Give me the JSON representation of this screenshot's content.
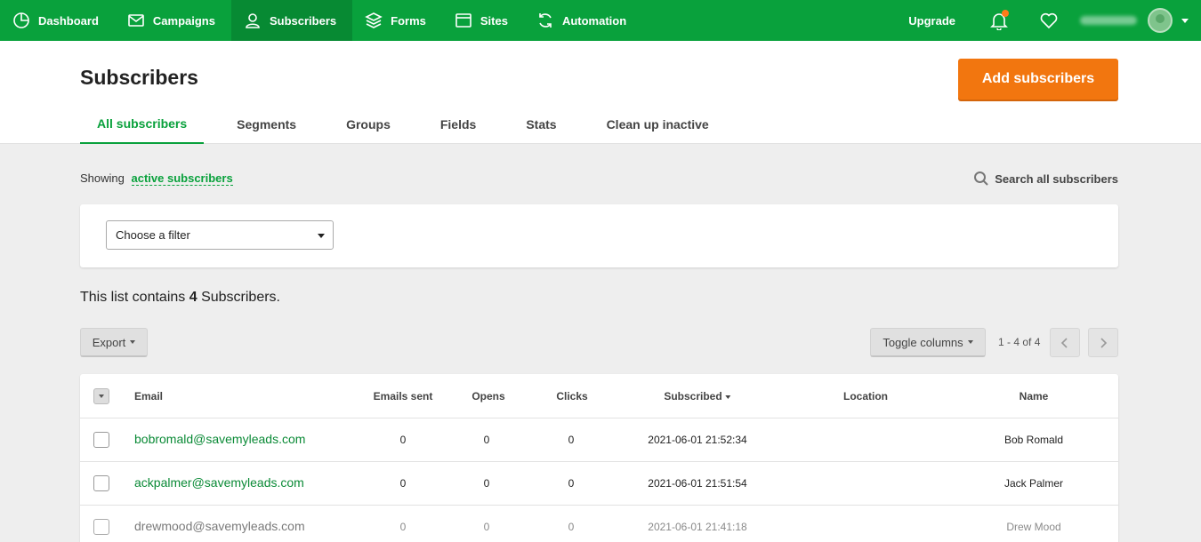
{
  "nav": {
    "items": [
      {
        "label": "Dashboard",
        "icon": "dashboard-icon"
      },
      {
        "label": "Campaigns",
        "icon": "envelope-icon"
      },
      {
        "label": "Subscribers",
        "icon": "user-icon",
        "active": true
      },
      {
        "label": "Forms",
        "icon": "layers-icon"
      },
      {
        "label": "Sites",
        "icon": "browser-window-icon"
      },
      {
        "label": "Automation",
        "icon": "refresh-icon"
      }
    ],
    "upgrade": "Upgrade",
    "has_notification": true
  },
  "header": {
    "title": "Subscribers",
    "add_button": "Add subscribers",
    "tabs": [
      "All subscribers",
      "Segments",
      "Groups",
      "Fields",
      "Stats",
      "Clean up inactive"
    ],
    "active_tab": "All subscribers"
  },
  "filters": {
    "showing_prefix": "Showing",
    "showing_link": "active subscribers",
    "search_label": "Search all subscribers",
    "filter_placeholder": "Choose a filter"
  },
  "summary": {
    "prefix": "This list contains",
    "count": "4",
    "suffix": "Subscribers."
  },
  "toolbar": {
    "export": "Export",
    "toggle_columns": "Toggle columns",
    "pager": "1 - 4 of 4"
  },
  "table": {
    "headers": {
      "email": "Email",
      "emails_sent": "Emails sent",
      "opens": "Opens",
      "clicks": "Clicks",
      "subscribed": "Subscribed",
      "location": "Location",
      "name": "Name"
    },
    "rows": [
      {
        "email": "bobromald@savemyleads.com",
        "emails_sent": "0",
        "opens": "0",
        "clicks": "0",
        "subscribed": "2021-06-01 21:52:34",
        "location": "",
        "name": "Bob Romald"
      },
      {
        "email": "ackpalmer@savemyleads.com",
        "emails_sent": "0",
        "opens": "0",
        "clicks": "0",
        "subscribed": "2021-06-01 21:51:54",
        "location": "",
        "name": "Jack Palmer"
      },
      {
        "email": "drewmood@savemyleads.com",
        "emails_sent": "0",
        "opens": "0",
        "clicks": "0",
        "subscribed": "2021-06-01 21:41:18",
        "location": "",
        "name": "Drew Mood"
      }
    ]
  },
  "colors": {
    "brand_green": "#09a13c",
    "accent_orange": "#f2760f"
  }
}
